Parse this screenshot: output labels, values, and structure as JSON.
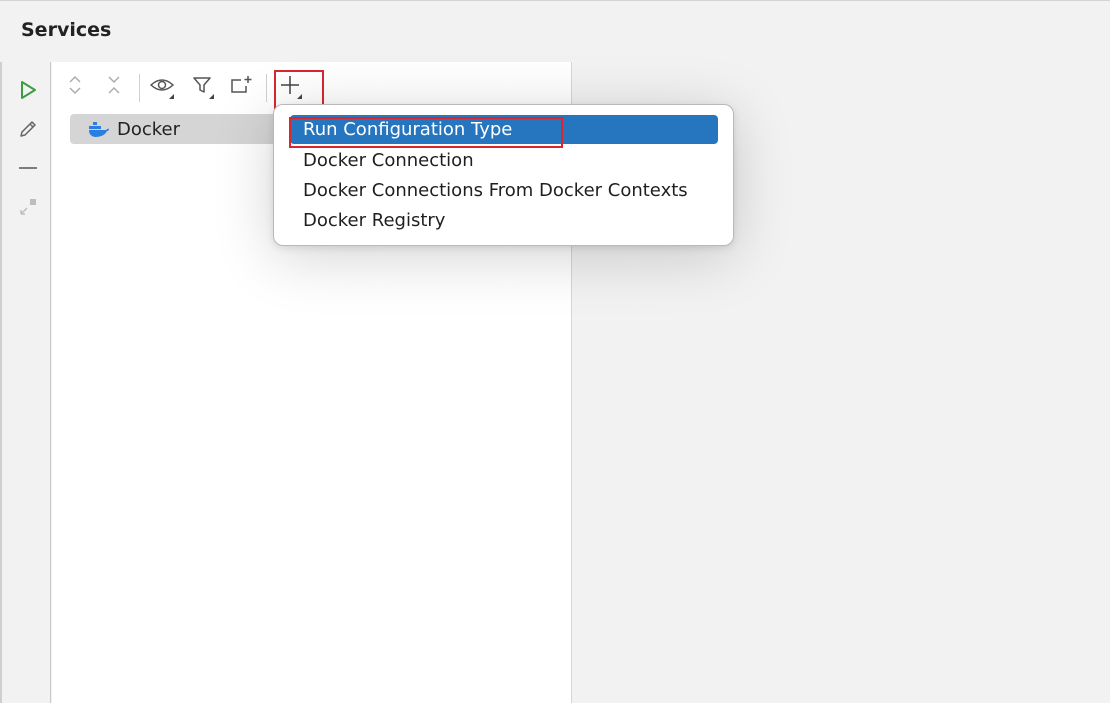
{
  "window": {
    "title": "Services"
  },
  "left_strip": {
    "buttons": [
      {
        "icon": "run-icon",
        "color": "#3f9c43"
      },
      {
        "icon": "edit-icon"
      },
      {
        "icon": "minimize-icon"
      },
      {
        "icon": "restore-icon"
      }
    ]
  },
  "toolbar": {
    "buttons": [
      {
        "icon": "expand-all-icon"
      },
      {
        "icon": "collapse-all-icon"
      },
      {
        "icon": "show-options-icon"
      },
      {
        "icon": "filter-icon"
      },
      {
        "icon": "new-tab-icon"
      },
      {
        "icon": "add-service-icon"
      }
    ]
  },
  "tree": {
    "items": [
      {
        "label": "Docker",
        "icon": "docker-icon",
        "icon_color": "#2a7de1"
      }
    ]
  },
  "add_menu": {
    "items": [
      {
        "label": "Run Configuration Type",
        "selected": true
      },
      {
        "label": "Docker Connection"
      },
      {
        "label": "Docker Connections From Docker Contexts"
      },
      {
        "label": "Docker Registry"
      }
    ]
  },
  "colors": {
    "selection": "#2675bf",
    "highlight_frame": "#d9262f",
    "run_icon": "#3f9c43",
    "docker_icon": "#2a7de1"
  }
}
